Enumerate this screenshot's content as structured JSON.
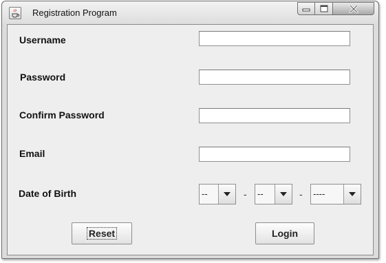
{
  "window": {
    "title": "Registration Program",
    "icon": "java-cup-icon"
  },
  "form": {
    "username_label": "Username",
    "username_value": "",
    "password_label": "Password",
    "password_value": "",
    "confirm_password_label": "Confirm Password",
    "confirm_password_value": "",
    "email_label": "Email",
    "email_value": "",
    "dob_label": "Date of Birth",
    "dob_day": "--",
    "dob_month": "--",
    "dob_year": "----",
    "separator": "-"
  },
  "buttons": {
    "reset_label": "Reset",
    "login_label": "Login"
  },
  "colors": {
    "window_frame": "#dcdcdc",
    "panel": "#eeeeee",
    "field": "#ffffff"
  }
}
